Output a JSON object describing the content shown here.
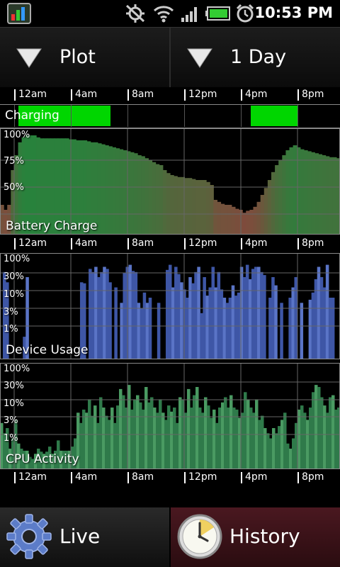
{
  "status_bar": {
    "time": "10:53 PM"
  },
  "toolbar": {
    "plot_label": "Plot",
    "range_label": "1 Day"
  },
  "axis": {
    "labels": [
      "12am",
      "4am",
      "8am",
      "12pm",
      "4pm",
      "8pm"
    ]
  },
  "charging": {
    "label": "Charging",
    "segments": [
      [
        0.3,
        6.8
      ],
      [
        16.7,
        20.0
      ]
    ]
  },
  "battery": {
    "label": "Battery Charge",
    "ticks": [
      "100%",
      "75%",
      "50%"
    ],
    "series": [
      30,
      25,
      30,
      65,
      80,
      93,
      98,
      100,
      100,
      100,
      98,
      97,
      97,
      97,
      97,
      97,
      97,
      97,
      97,
      96,
      96,
      95,
      95,
      95,
      94,
      93,
      93,
      92,
      91,
      90,
      89,
      88,
      87,
      86,
      85,
      84,
      83,
      82,
      80,
      79,
      77,
      75,
      73,
      71,
      70,
      65,
      62,
      60,
      59,
      58,
      58,
      57,
      57,
      56,
      55,
      55,
      55,
      53,
      50,
      35,
      33,
      31,
      30,
      30,
      28,
      26,
      25,
      22,
      24,
      25,
      28,
      33,
      40,
      47,
      55,
      63,
      70,
      75,
      80,
      85,
      88,
      90,
      88,
      86,
      85,
      84,
      83,
      82,
      81,
      80,
      79,
      78,
      78,
      77
    ]
  },
  "device_usage": {
    "label": "Device Usage",
    "ticks": [
      "100%",
      "30%",
      "10%",
      "3%",
      "1%"
    ],
    "series": [
      0,
      85,
      75,
      0,
      0,
      0,
      0,
      0,
      22,
      80,
      0,
      0,
      0,
      0,
      0,
      0,
      0,
      0,
      0,
      0,
      0,
      0,
      0,
      0,
      0,
      0,
      0,
      0,
      75,
      74,
      0,
      88,
      85,
      90,
      80,
      85,
      90,
      88,
      75,
      0,
      70,
      0,
      55,
      84,
      90,
      92,
      86,
      85,
      55,
      50,
      65,
      55,
      60,
      0,
      0,
      55,
      0,
      0,
      87,
      92,
      70,
      90,
      83,
      75,
      68,
      60,
      80,
      74,
      85,
      90,
      45,
      80,
      62,
      70,
      90,
      70,
      85,
      68,
      60,
      55,
      60,
      72,
      62,
      65,
      90,
      80,
      92,
      78,
      88,
      90,
      90,
      85,
      82,
      0,
      60,
      80,
      72,
      0,
      55,
      0,
      0,
      60,
      70,
      80,
      0,
      55,
      0,
      0,
      58,
      65,
      78,
      90,
      80,
      70,
      92,
      60,
      60,
      0,
      0
    ]
  },
  "cpu_activity": {
    "label": "CPU Activity",
    "ticks": [
      "100%",
      "30%",
      "10%",
      "3%",
      "1%"
    ],
    "series": [
      45,
      35,
      40,
      20,
      30,
      48,
      25,
      20,
      18,
      18,
      12,
      10,
      15,
      20,
      17,
      15,
      17,
      22,
      15,
      18,
      28,
      18,
      18,
      18,
      18,
      22,
      30,
      55,
      45,
      58,
      55,
      68,
      52,
      62,
      45,
      70,
      60,
      52,
      48,
      60,
      45,
      62,
      78,
      72,
      60,
      82,
      58,
      68,
      72,
      65,
      58,
      80,
      65,
      70,
      60,
      55,
      68,
      55,
      48,
      62,
      56,
      60,
      45,
      70,
      68,
      55,
      78,
      60,
      72,
      80,
      60,
      55,
      70,
      62,
      50,
      58,
      45,
      60,
      65,
      70,
      60,
      72,
      60,
      58,
      50,
      55,
      75,
      68,
      60,
      55,
      68,
      48,
      52,
      40,
      35,
      30,
      40,
      35,
      42,
      48,
      55,
      25,
      20,
      30,
      45,
      58,
      62,
      55,
      48,
      60,
      75,
      82,
      80,
      70,
      62,
      55,
      70,
      72,
      58,
      60
    ]
  }
}
